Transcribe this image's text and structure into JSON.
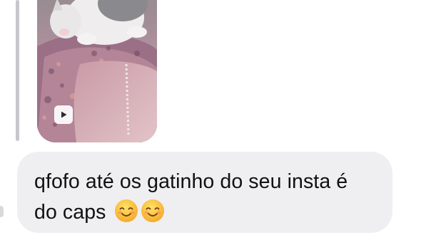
{
  "thread": {
    "shared_media": {
      "kind": "video",
      "badge_icon": "play-icon"
    },
    "message": {
      "line1": "qfofo até os gatinho do seu insta é",
      "line2": "do caps",
      "emojis": [
        "smiling-face-icon",
        "smiling-face-icon"
      ]
    }
  },
  "colors": {
    "bubble_background": "#efeff1",
    "reply_bar": "#c7c7cc",
    "text": "#111111"
  }
}
